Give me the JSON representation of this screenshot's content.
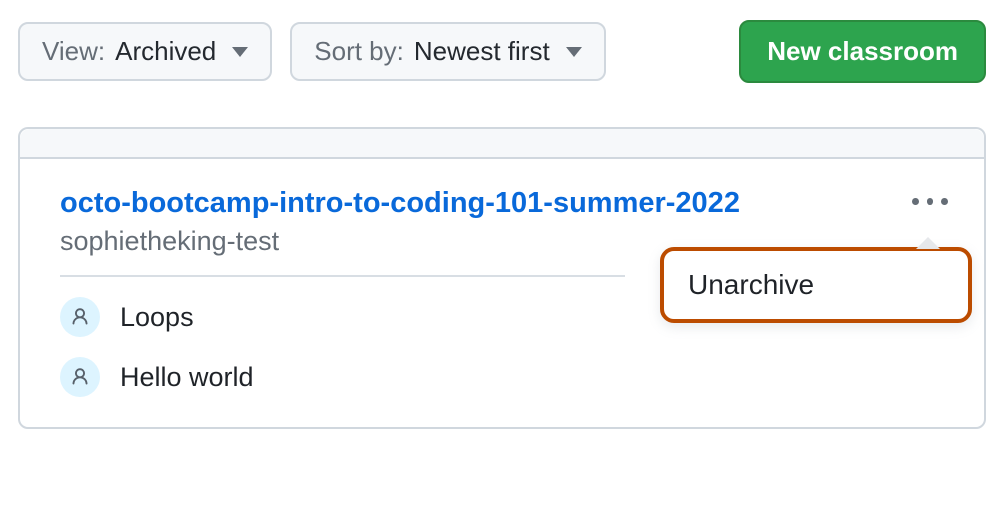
{
  "toolbar": {
    "view_label": "View:",
    "view_value": "Archived",
    "sort_label": "Sort by:",
    "sort_value": "Newest first",
    "new_classroom": "New classroom"
  },
  "classroom": {
    "title": "octo-bootcamp-intro-to-coding-101-summer-2022",
    "org": "sophietheking-test",
    "assignments": [
      {
        "name": "Loops"
      },
      {
        "name": "Hello world"
      }
    ]
  },
  "menu": {
    "unarchive": "Unarchive"
  }
}
